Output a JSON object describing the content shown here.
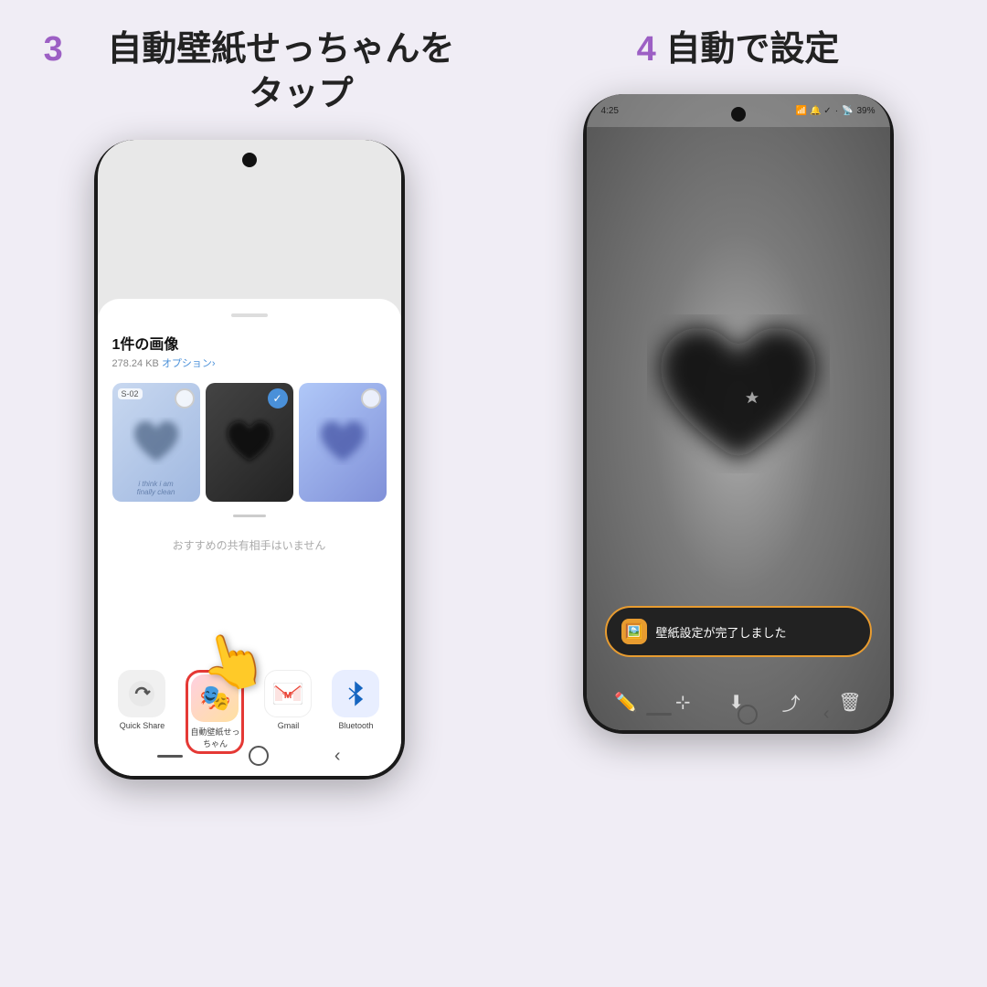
{
  "background_color": "#f0edf5",
  "left_panel": {
    "step_number": "3",
    "step_text": "自動壁紙せっちゃんを\nタップ"
  },
  "right_panel": {
    "step_number": "4",
    "step_text": "自動で設定"
  },
  "left_phone": {
    "share_sheet": {
      "title": "1件の画像",
      "subtitle": "278.24 KB",
      "options_link": "オプション›",
      "recommended_text": "おすすめの共有相手はいません"
    },
    "apps": [
      {
        "id": "quick-share",
        "label": "Quick Share",
        "icon": "↻"
      },
      {
        "id": "auto-wallpaper",
        "label": "自動壁紙せっ\nちゃん",
        "icon": "🎭"
      },
      {
        "id": "gmail",
        "label": "Gmail",
        "icon": "M"
      },
      {
        "id": "bluetooth",
        "label": "Bluetooth",
        "icon": "⚡"
      }
    ]
  },
  "right_phone": {
    "status_bar": {
      "time": "4:25",
      "battery": "39%"
    },
    "toast": {
      "text": "壁紙設定が完了しました"
    }
  }
}
